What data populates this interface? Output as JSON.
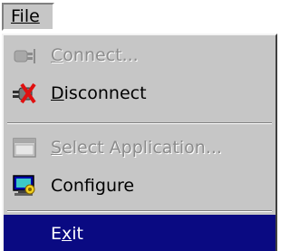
{
  "menubar": {
    "file_label": "File"
  },
  "menu": {
    "items": [
      {
        "label_first": "C",
        "label_rest": "onnect...",
        "icon": "plug-icon",
        "enabled": false
      },
      {
        "label_first": "D",
        "label_rest": "isconnect",
        "icon": "disconnect-plug-icon",
        "enabled": true
      },
      {
        "label_first": "S",
        "label_rest": "elect Application...",
        "icon": "window-icon",
        "enabled": false
      },
      {
        "label_first": "",
        "label_rest": "Configure",
        "icon": "configure-icon",
        "enabled": true
      },
      {
        "label_pre": "E",
        "label_u": "x",
        "label_post": "it",
        "enabled": true,
        "selected": true
      }
    ]
  },
  "colors": {
    "menu_bg": "#c6c6c6",
    "highlight": "#0a0a82",
    "disabled_text": "#8c8c8c"
  }
}
